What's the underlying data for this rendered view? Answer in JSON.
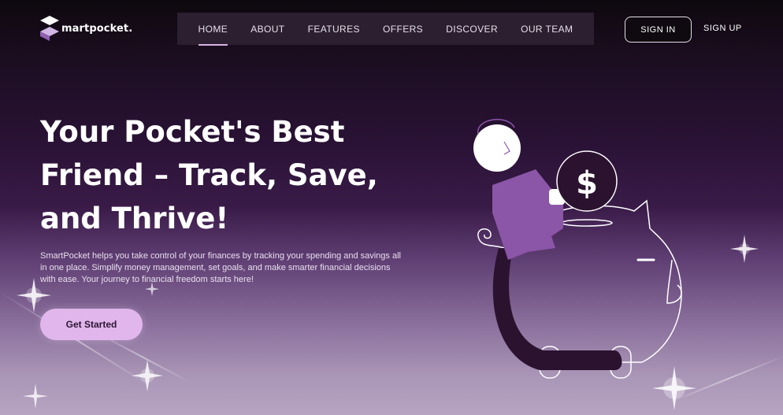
{
  "brand": {
    "name": "martpocket."
  },
  "nav": {
    "items": [
      {
        "label": "HOME",
        "active": true
      },
      {
        "label": "ABOUT",
        "active": false
      },
      {
        "label": "FEATURES",
        "active": false
      },
      {
        "label": "OFFERS",
        "active": false
      },
      {
        "label": "DISCOVER",
        "active": false
      },
      {
        "label": "OUR TEAM",
        "active": false
      }
    ]
  },
  "auth": {
    "sign_in": "SIGN IN",
    "sign_up": "SIGN UP"
  },
  "hero": {
    "title": "Your Pocket's Best Friend – Track, Save, and Thrive!",
    "description": "SmartPocket helps you take control of your finances by tracking your spending and savings all in one place. Simplify money management, set goals, and make smarter financial decisions with ease. Your journey to financial freedom starts here!",
    "cta": "Get Started"
  },
  "illustration": {
    "coin_symbol": "$",
    "icon": "piggy-bank-illustration"
  },
  "colors": {
    "accent": "#e0b6ec",
    "nav_bg": "#2c1f30",
    "figure_purple": "#8b56a7",
    "dark_plum": "#2b1330"
  }
}
